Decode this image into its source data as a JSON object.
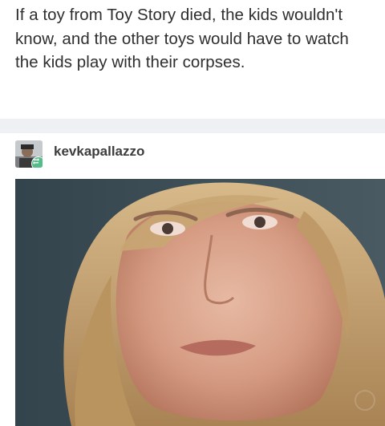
{
  "post": {
    "text": "If a toy from Toy Story died, the kids wouldn't know, and the other toys would have to watch the kids play with their corpses."
  },
  "reblog": {
    "username": "kevkapallazzo",
    "avatar_icon": "user-avatar-icon",
    "badge_icon": "reblog-icon",
    "badge_color": "#56bc8a"
  },
  "image": {
    "subject": "woman-face-photo"
  }
}
